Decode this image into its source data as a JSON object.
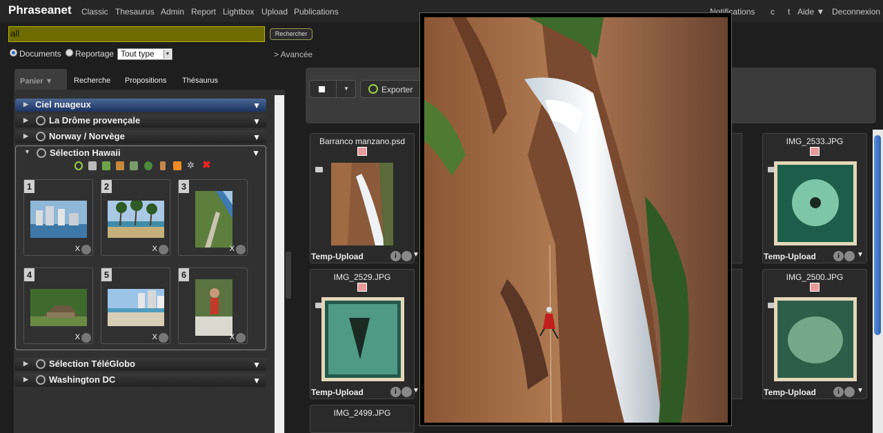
{
  "nav": {
    "brand": "Phraseanet",
    "links": [
      "Classic",
      "Thesaurus",
      "Admin",
      "Report",
      "Lightbox",
      "Upload",
      "Publications"
    ],
    "right": [
      "Notifications",
      "c",
      "t",
      "Aide ▼",
      "Deconnexion"
    ]
  },
  "search": {
    "query": "all",
    "button_label": "Rechercher",
    "radio_documents": "Documents",
    "radio_reportage": "Reportage",
    "type_value": "Tout type",
    "advanced": "> Avancée"
  },
  "left_tabs": {
    "panier": "Panier ▼",
    "recherche": "Recherche",
    "propositions": "Propositions",
    "thesaurus": "Thésaurus"
  },
  "baskets": [
    {
      "name": "Ciel nuageux",
      "selected": true
    },
    {
      "name": "La Drôme provençale",
      "selected": false
    },
    {
      "name": "Norway / Norvège",
      "selected": false
    },
    {
      "name": "Sélection Hawaii",
      "selected": false
    },
    {
      "name": "Sélection TéléGlobo",
      "selected": false
    },
    {
      "name": "Washington DC",
      "selected": false
    }
  ],
  "basket_items": [
    {
      "num": "1",
      "x": "X"
    },
    {
      "num": "2",
      "x": "X"
    },
    {
      "num": "3",
      "x": "X"
    },
    {
      "num": "4",
      "x": "X"
    },
    {
      "num": "5",
      "x": "X"
    },
    {
      "num": "6",
      "x": "X"
    }
  ],
  "toolbar": {
    "export_label": "Exporter"
  },
  "results": [
    {
      "title": "Barranco manzano.psd",
      "collection": "Temp-Upload",
      "info": "i",
      "more": "▼"
    },
    {
      "title": "IMG_2533.JPG",
      "collection": "Temp-Upload",
      "info": "i",
      "more": "▼"
    },
    {
      "title": "IMG_2529.JPG",
      "collection": "Temp-Upload",
      "info": "i",
      "more": "▼"
    },
    {
      "title": "IMG_2500.JPG",
      "collection": "Temp-Upload",
      "info": "i",
      "more": "▼"
    },
    {
      "title": "IMG_2499.JPG"
    }
  ],
  "colors": {
    "search_bg": "#6e6b00",
    "selected_basket": "#2f4e86",
    "collection_swatch": "#e79a9a",
    "export_icon": "#9bd04a"
  }
}
